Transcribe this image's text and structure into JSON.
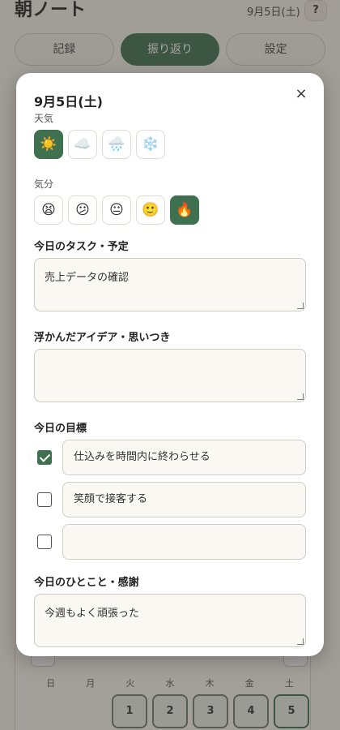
{
  "app": {
    "title": "朝ノート",
    "date": "9月5日(土)",
    "help_label": "?",
    "tabs": [
      {
        "label": "記録",
        "active": false
      },
      {
        "label": "振り返り",
        "active": true
      },
      {
        "label": "設定",
        "active": false
      }
    ],
    "calendar": {
      "weekdays": [
        "日",
        "月",
        "火",
        "水",
        "木",
        "金",
        "土"
      ],
      "days": [
        "1",
        "2",
        "3",
        "4",
        "5"
      ]
    }
  },
  "modal": {
    "title": "9月5日(土)",
    "close_label": "×",
    "weather": {
      "label": "天気",
      "options": [
        {
          "icon": "sun-icon",
          "glyph": "☀️",
          "selected": true
        },
        {
          "icon": "cloud-icon",
          "glyph": "☁️",
          "selected": false
        },
        {
          "icon": "rain-icon",
          "glyph": "🌧️",
          "selected": false
        },
        {
          "icon": "snow-icon",
          "glyph": "❄️",
          "selected": false
        }
      ]
    },
    "mood": {
      "label": "気分",
      "options": [
        {
          "icon": "tired-face-icon",
          "glyph": "😫",
          "selected": false
        },
        {
          "icon": "confused-face-icon",
          "glyph": "😕",
          "selected": false
        },
        {
          "icon": "neutral-face-icon",
          "glyph": "😐",
          "selected": false
        },
        {
          "icon": "smile-face-icon",
          "glyph": "🙂",
          "selected": false
        },
        {
          "icon": "fire-icon",
          "glyph": "🔥",
          "selected": true
        }
      ]
    },
    "tasks": {
      "label": "今日のタスク・予定",
      "value": "売上データの確認"
    },
    "ideas": {
      "label": "浮かんだアイデア・思いつき",
      "value": ""
    },
    "goals": {
      "label": "今日の目標",
      "items": [
        {
          "text": "仕込みを時間内に終わらせる",
          "checked": true
        },
        {
          "text": "笑顔で接客する",
          "checked": false
        },
        {
          "text": "",
          "checked": false
        }
      ]
    },
    "gratitude": {
      "label": "今日のひとこと・感謝",
      "value": "今週もよく頑張った"
    }
  },
  "colors": {
    "accent": "#3f7050",
    "background": "#f4f1ea"
  }
}
